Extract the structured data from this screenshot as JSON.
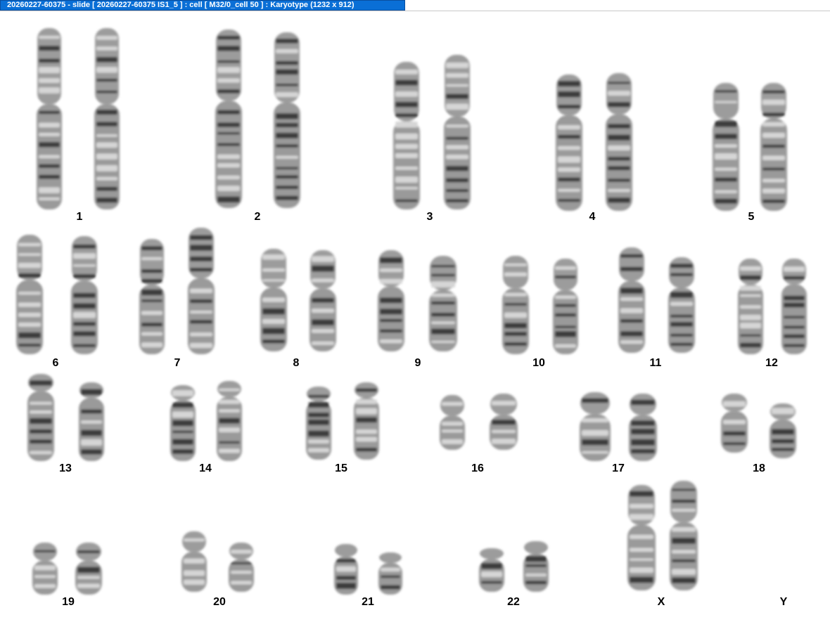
{
  "window": {
    "title": "20260227-60375 - slide [ 20260227-60375 IS1_5 ] : cell [ M32/0_cell 50 ] : Karyotype  (1232 x 912)"
  },
  "karyotype": {
    "pairs": [
      {
        "label": "1",
        "count": 2
      },
      {
        "label": "2",
        "count": 2
      },
      {
        "label": "3",
        "count": 2
      },
      {
        "label": "4",
        "count": 2
      },
      {
        "label": "5",
        "count": 2
      },
      {
        "label": "6",
        "count": 2
      },
      {
        "label": "7",
        "count": 2
      },
      {
        "label": "8",
        "count": 2
      },
      {
        "label": "9",
        "count": 2
      },
      {
        "label": "10",
        "count": 2
      },
      {
        "label": "11",
        "count": 2
      },
      {
        "label": "12",
        "count": 2
      },
      {
        "label": "13",
        "count": 2
      },
      {
        "label": "14",
        "count": 2
      },
      {
        "label": "15",
        "count": 2
      },
      {
        "label": "16",
        "count": 2
      },
      {
        "label": "17",
        "count": 2
      },
      {
        "label": "18",
        "count": 2
      },
      {
        "label": "19",
        "count": 2
      },
      {
        "label": "20",
        "count": 2
      },
      {
        "label": "21",
        "count": 2
      },
      {
        "label": "22",
        "count": 2
      },
      {
        "label": "X",
        "count": 2
      },
      {
        "label": "Y",
        "count": 0
      }
    ]
  }
}
